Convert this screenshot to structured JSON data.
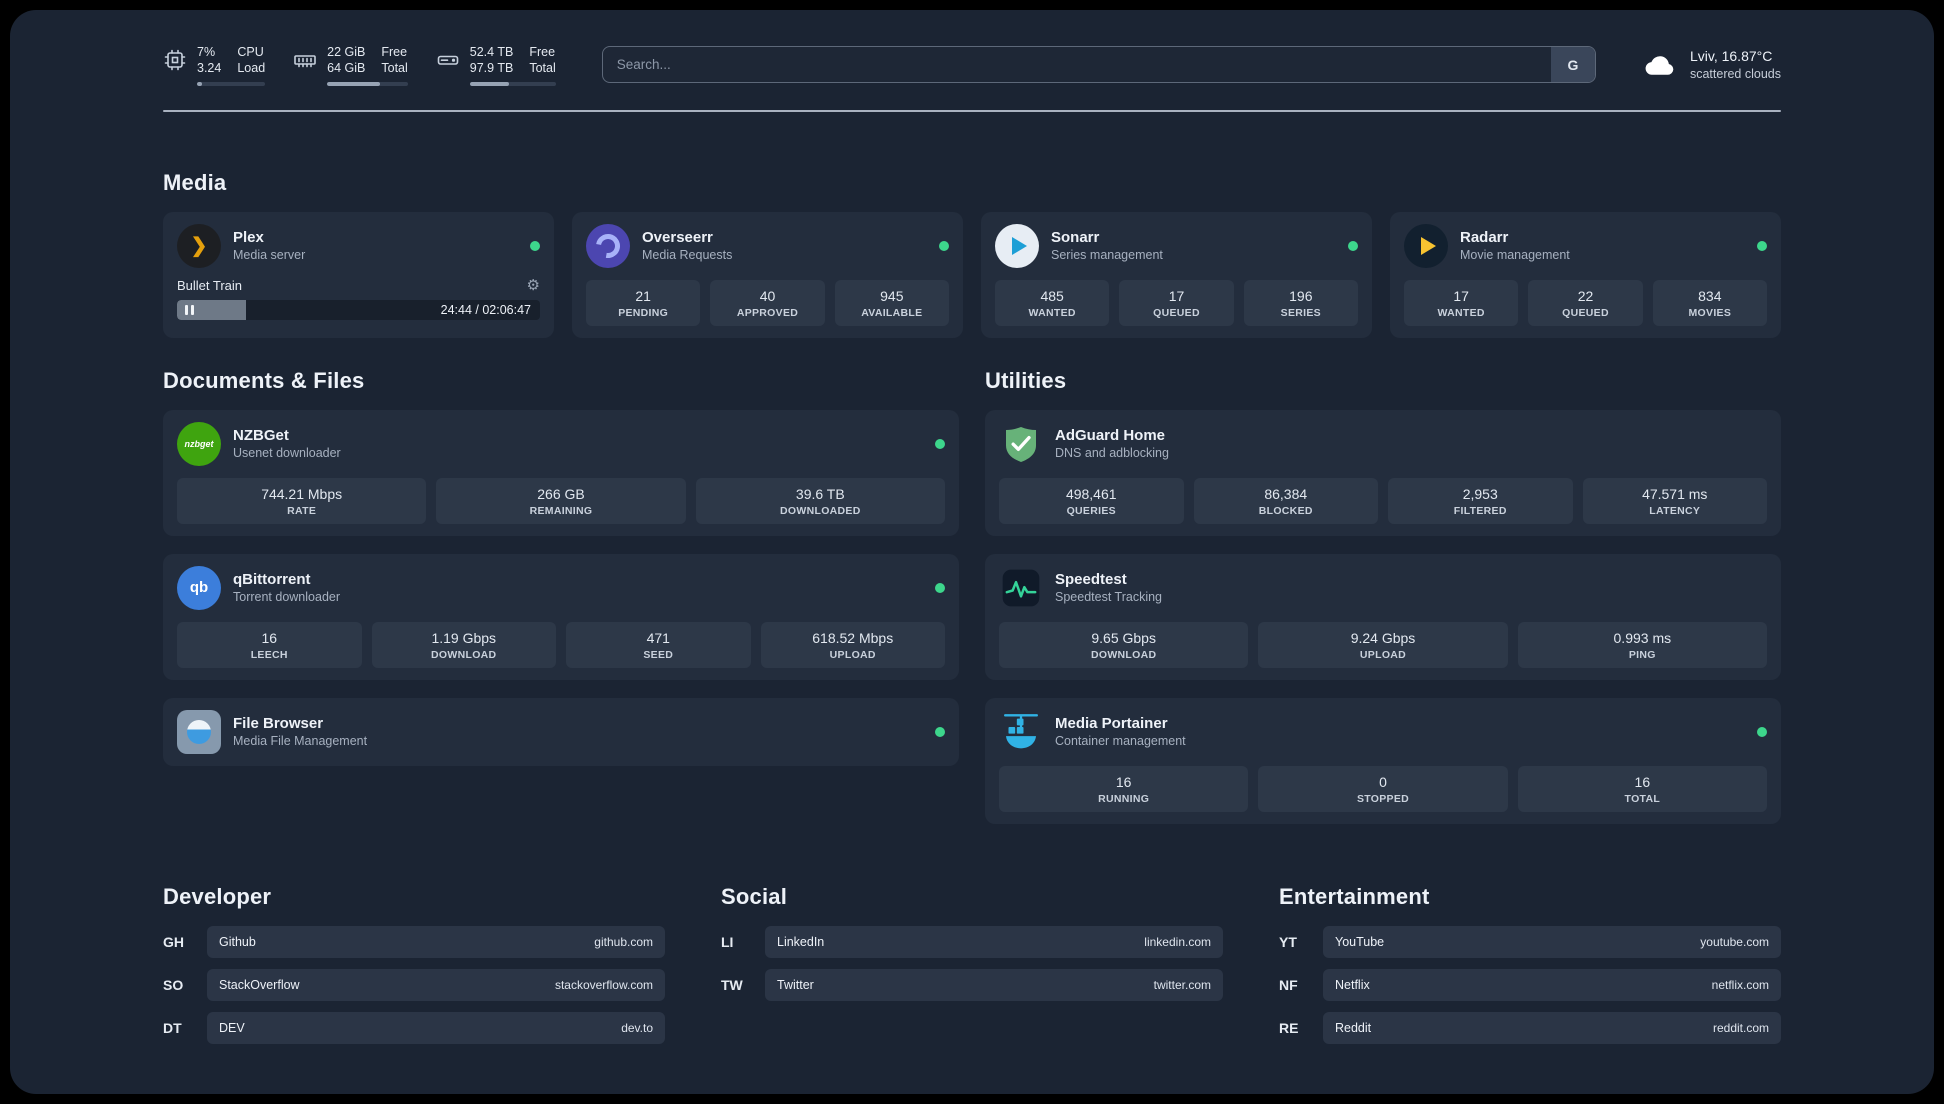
{
  "colors": {
    "bg": "#1b2433",
    "card": "#232d3d",
    "stat": "#2d3848",
    "text": "#e8edf4",
    "muted": "#9fa9b8",
    "green": "#3dd68c"
  },
  "icons": {
    "plex_glyph": "❯",
    "nzbget_label": "nzbget",
    "qbittorrent_label": "qb",
    "gear_glyph": "⚙"
  },
  "header": {
    "cpu": {
      "percent": "7%",
      "load": "3.24",
      "label1": "CPU",
      "label2": "Load",
      "progress_percent": 8
    },
    "memory": {
      "free": "22 GiB",
      "total": "64 GiB",
      "label1": "Free",
      "label2": "Total",
      "progress_percent": 66
    },
    "disk": {
      "free": "52.4 TB",
      "total": "97.9 TB",
      "label1": "Free",
      "label2": "Total",
      "progress_percent": 46
    },
    "search": {
      "placeholder": "Search...",
      "provider_label": "G"
    },
    "weather": {
      "location": "Lviv, 16.87°C",
      "condition": "scattered clouds"
    }
  },
  "media": {
    "title": "Media",
    "cards": [
      {
        "name": "Plex",
        "subtitle": "Media server",
        "status": "online",
        "player": {
          "title": "Bullet Train",
          "time": "24:44 / 02:06:47",
          "progress_percent": 19
        }
      },
      {
        "name": "Overseerr",
        "subtitle": "Media Requests",
        "status": "online",
        "stats": [
          {
            "value": "21",
            "label": "PENDING"
          },
          {
            "value": "40",
            "label": "APPROVED"
          },
          {
            "value": "945",
            "label": "AVAILABLE"
          }
        ]
      },
      {
        "name": "Sonarr",
        "subtitle": "Series management",
        "status": "online",
        "stats": [
          {
            "value": "485",
            "label": "WANTED"
          },
          {
            "value": "17",
            "label": "QUEUED"
          },
          {
            "value": "196",
            "label": "SERIES"
          }
        ]
      },
      {
        "name": "Radarr",
        "subtitle": "Movie management",
        "status": "online",
        "stats": [
          {
            "value": "17",
            "label": "WANTED"
          },
          {
            "value": "22",
            "label": "QUEUED"
          },
          {
            "value": "834",
            "label": "MOVIES"
          }
        ]
      }
    ]
  },
  "documents": {
    "title": "Documents & Files",
    "cards": [
      {
        "name": "NZBGet",
        "subtitle": "Usenet downloader",
        "status": "online",
        "stats": [
          {
            "value": "744.21 Mbps",
            "label": "RATE"
          },
          {
            "value": "266 GB",
            "label": "REMAINING"
          },
          {
            "value": "39.6 TB",
            "label": "DOWNLOADED"
          }
        ]
      },
      {
        "name": "qBittorrent",
        "subtitle": "Torrent downloader",
        "status": "online",
        "stats": [
          {
            "value": "16",
            "label": "LEECH"
          },
          {
            "value": "1.19 Gbps",
            "label": "DOWNLOAD"
          },
          {
            "value": "471",
            "label": "SEED"
          },
          {
            "value": "618.52 Mbps",
            "label": "UPLOAD"
          }
        ]
      },
      {
        "name": "File Browser",
        "subtitle": "Media File Management",
        "status": "online",
        "stats": []
      }
    ]
  },
  "utilities": {
    "title": "Utilities",
    "cards": [
      {
        "name": "AdGuard Home",
        "subtitle": "DNS and adblocking",
        "stats": [
          {
            "value": "498,461",
            "label": "QUERIES"
          },
          {
            "value": "86,384",
            "label": "BLOCKED"
          },
          {
            "value": "2,953",
            "label": "FILTERED"
          },
          {
            "value": "47.571 ms",
            "label": "LATENCY"
          }
        ]
      },
      {
        "name": "Speedtest",
        "subtitle": "Speedtest Tracking",
        "stats": [
          {
            "value": "9.65 Gbps",
            "label": "DOWNLOAD"
          },
          {
            "value": "9.24 Gbps",
            "label": "UPLOAD"
          },
          {
            "value": "0.993 ms",
            "label": "PING"
          }
        ]
      },
      {
        "name": "Media Portainer",
        "subtitle": "Container management",
        "status": "online",
        "stats": [
          {
            "value": "16",
            "label": "RUNNING"
          },
          {
            "value": "0",
            "label": "STOPPED"
          },
          {
            "value": "16",
            "label": "TOTAL"
          }
        ]
      }
    ]
  },
  "bookmarks": [
    {
      "title": "Developer",
      "links": [
        {
          "abbr": "GH",
          "name": "Github",
          "domain": "github.com"
        },
        {
          "abbr": "SO",
          "name": "StackOverflow",
          "domain": "stackoverflow.com"
        },
        {
          "abbr": "DT",
          "name": "DEV",
          "domain": "dev.to"
        }
      ]
    },
    {
      "title": "Social",
      "links": [
        {
          "abbr": "LI",
          "name": "LinkedIn",
          "domain": "linkedin.com"
        },
        {
          "abbr": "TW",
          "name": "Twitter",
          "domain": "twitter.com"
        }
      ]
    },
    {
      "title": "Entertainment",
      "links": [
        {
          "abbr": "YT",
          "name": "YouTube",
          "domain": "youtube.com"
        },
        {
          "abbr": "NF",
          "name": "Netflix",
          "domain": "netflix.com"
        },
        {
          "abbr": "RE",
          "name": "Reddit",
          "domain": "reddit.com"
        }
      ]
    }
  ]
}
